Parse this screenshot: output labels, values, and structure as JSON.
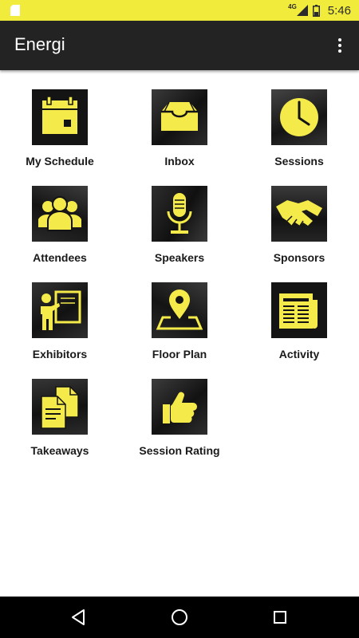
{
  "status_bar": {
    "network": "4G",
    "time": "5:46"
  },
  "app_bar": {
    "title": "Energi"
  },
  "tiles": [
    {
      "label": "My Schedule",
      "icon": "calendar-icon"
    },
    {
      "label": "Inbox",
      "icon": "inbox-tray-icon"
    },
    {
      "label": "Sessions",
      "icon": "clock-icon"
    },
    {
      "label": "Attendees",
      "icon": "people-group-icon"
    },
    {
      "label": "Speakers",
      "icon": "microphone-icon"
    },
    {
      "label": "Sponsors",
      "icon": "handshake-icon"
    },
    {
      "label": "Exhibitors",
      "icon": "presenter-board-icon"
    },
    {
      "label": "Floor Plan",
      "icon": "map-pin-icon"
    },
    {
      "label": "Activity",
      "icon": "newspaper-icon"
    },
    {
      "label": "Takeaways",
      "icon": "documents-icon"
    },
    {
      "label": "Session Rating",
      "icon": "thumbs-up-icon"
    }
  ],
  "colors": {
    "accent": "#f4ea4a",
    "app_bar": "#232323",
    "status_bar": "#f1ec3c"
  }
}
